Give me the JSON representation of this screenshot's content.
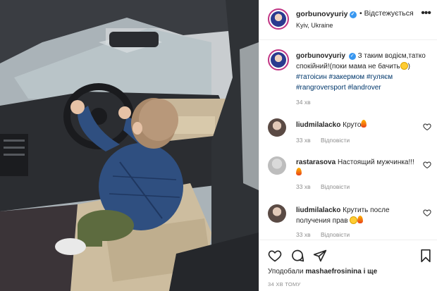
{
  "post": {
    "username": "gorbunovyuriy",
    "follow_status": "• Відстежується",
    "location": "Kyiv, Ukraine",
    "caption": {
      "username": "gorbunovyuriy",
      "text_before": "З таким водієм,татко спокійний!(поки мама не бачить",
      "text_after": ")",
      "hashtags": [
        "#татоісин",
        "#закермом",
        "#гуляєм",
        "#rangroversport",
        "#landrover"
      ],
      "time": "34 хв"
    },
    "comments": [
      {
        "username": "liudmilalacko",
        "text": "Круто",
        "time": "33 хв",
        "reply": "Відповісти"
      },
      {
        "username": "rastarasova",
        "text": "Настоящий мужчинка!!!",
        "time": "33 хв",
        "reply": "Відповісти"
      },
      {
        "username": "liudmilalacko",
        "text": "Крутить после получения прав",
        "time": "33 хв",
        "reply": "Відповісти"
      }
    ],
    "likes_prefix": "Уподобали",
    "likes_user": "mashaefrosinina",
    "likes_suffix": "і ще",
    "post_time": "34 ХВ ТОМУ"
  },
  "icons": {
    "more": "more-options-icon",
    "verified": "verified-badge-icon",
    "like": "heart-icon",
    "comment": "comment-icon",
    "share": "share-icon",
    "save": "bookmark-icon"
  },
  "colors": {
    "link": "#00376b",
    "meta": "#8e8e8e",
    "verified": "#3897f0",
    "avatar_ring": "#c13584"
  }
}
